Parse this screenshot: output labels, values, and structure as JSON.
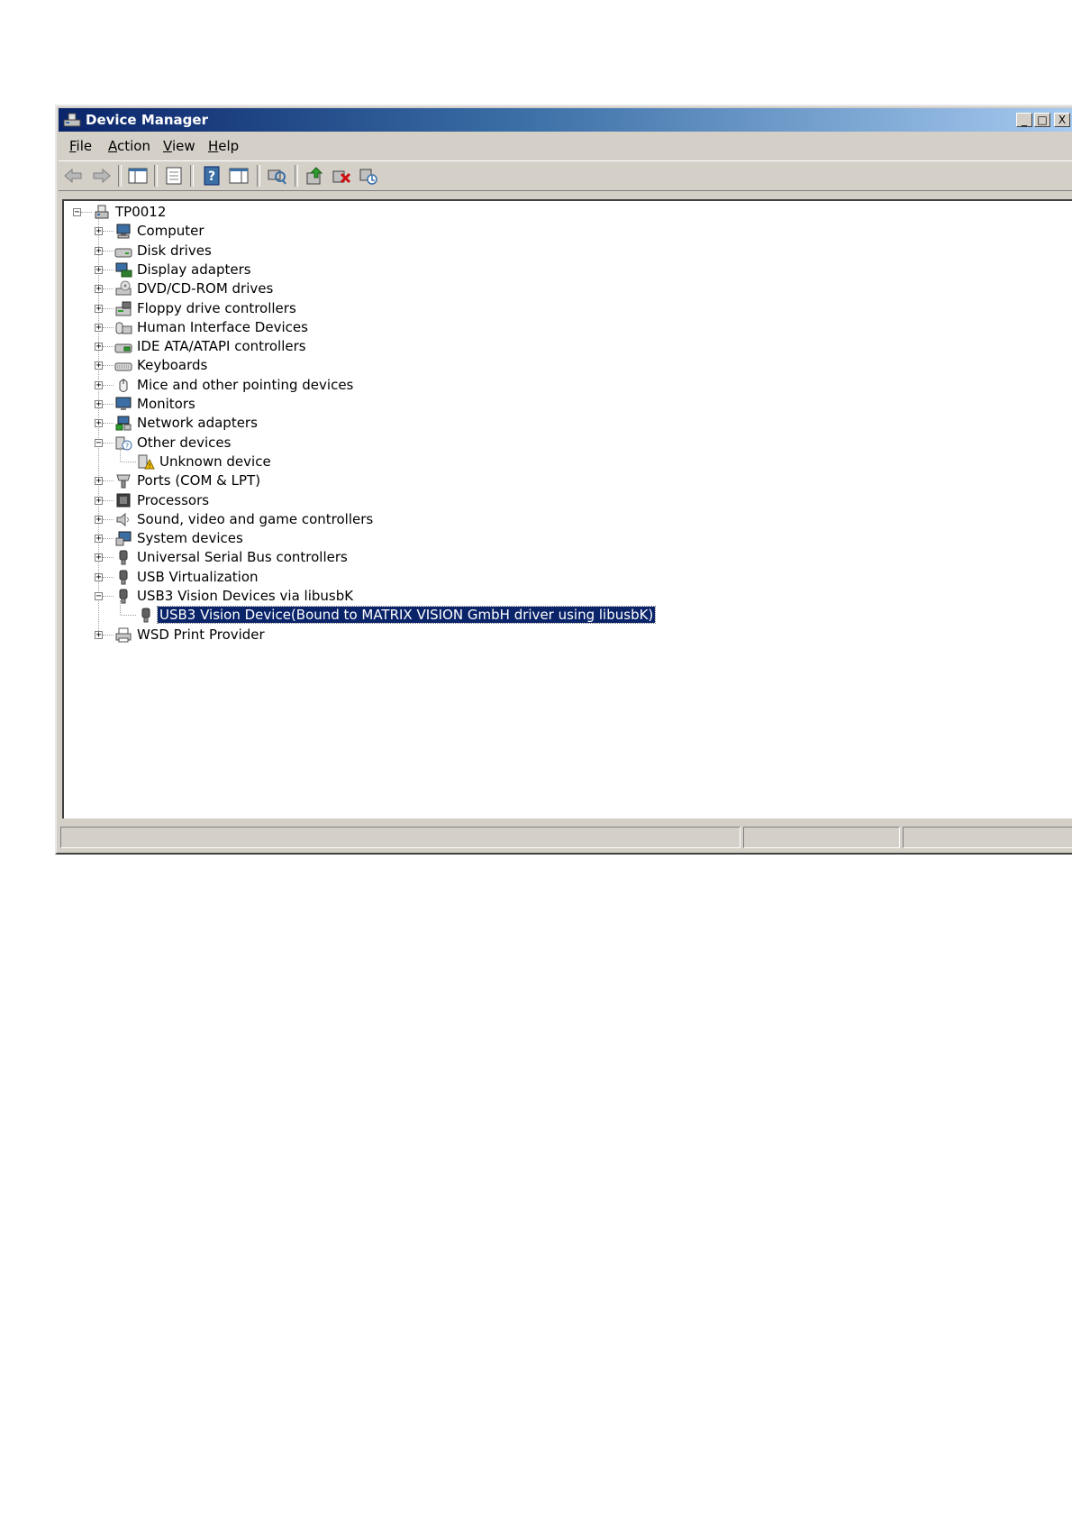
{
  "window": {
    "title": "Device Manager",
    "controls": {
      "minimize": "_",
      "maximize": "□",
      "close": "X"
    }
  },
  "menu": [
    {
      "label": "ile",
      "mnemonic": "F"
    },
    {
      "label": "ction",
      "mnemonic": "A"
    },
    {
      "label": "iew",
      "mnemonic": "V"
    },
    {
      "label": "elp",
      "mnemonic": "H"
    }
  ],
  "toolbar": [
    "back-icon",
    "forward-icon",
    "show-hide-console-tree-icon",
    "properties-icon",
    "help-icon",
    "action-pane-icon",
    "scan-hardware-changes-icon",
    "update-driver-icon",
    "uninstall-icon",
    "disable-device-icon"
  ],
  "tree": {
    "root": "TP0012",
    "items": [
      {
        "label": "Computer",
        "icon": "computer-icon"
      },
      {
        "label": "Disk drives",
        "icon": "disk-drive-icon"
      },
      {
        "label": "Display adapters",
        "icon": "display-adapter-icon"
      },
      {
        "label": "DVD/CD-ROM drives",
        "icon": "dvd-drive-icon"
      },
      {
        "label": "Floppy drive controllers",
        "icon": "floppy-controller-icon"
      },
      {
        "label": "Human Interface Devices",
        "icon": "hid-icon"
      },
      {
        "label": "IDE ATA/ATAPI controllers",
        "icon": "ide-controller-icon"
      },
      {
        "label": "Keyboards",
        "icon": "keyboard-icon"
      },
      {
        "label": "Mice and other pointing devices",
        "icon": "mouse-icon"
      },
      {
        "label": "Monitors",
        "icon": "monitor-icon"
      },
      {
        "label": "Network adapters",
        "icon": "network-adapter-icon"
      },
      {
        "label": "Other devices",
        "icon": "other-devices-icon",
        "expanded": true,
        "children": [
          {
            "label": "Unknown device",
            "icon": "unknown-device-warning-icon"
          }
        ]
      },
      {
        "label": "Ports (COM & LPT)",
        "icon": "port-icon"
      },
      {
        "label": "Processors",
        "icon": "processor-icon"
      },
      {
        "label": "Sound, video and game controllers",
        "icon": "sound-icon"
      },
      {
        "label": "System devices",
        "icon": "system-devices-icon"
      },
      {
        "label": "Universal Serial Bus controllers",
        "icon": "usb-icon"
      },
      {
        "label": "USB Virtualization",
        "icon": "usb-icon"
      },
      {
        "label": "USB3 Vision Devices via libusbK",
        "icon": "usb-icon",
        "expanded": true,
        "children": [
          {
            "label": "USB3 Vision Device(Bound to MATRIX VISION GmbH driver using libusbK)",
            "icon": "usb-device-icon",
            "selected": true
          }
        ]
      },
      {
        "label": "WSD Print Provider",
        "icon": "printer-icon"
      }
    ]
  },
  "colors": {
    "selection": "#0a246a",
    "title_gradient_start": "#0a246a",
    "title_gradient_end": "#a6caf0",
    "chrome": "#d4d0c8"
  }
}
